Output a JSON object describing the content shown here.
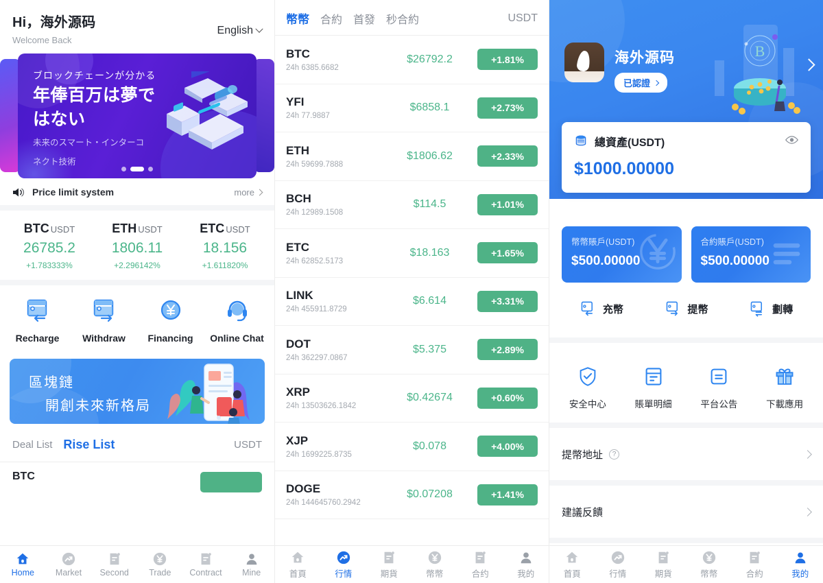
{
  "panel1": {
    "greeting": "Hi，海外源码",
    "welcome": "Welcome Back",
    "language": "English",
    "banner": {
      "line1": "ブロックチェーンが分かる",
      "line2": "年俸百万は夢で",
      "line3": "はない",
      "sub1": "未来のスマート・インターコ",
      "sub2": "ネクト技術"
    },
    "notice": {
      "text": "Price limit system",
      "more": "more"
    },
    "tickers": [
      {
        "symbol": "BTC",
        "unit": "USDT",
        "price": "26785.2",
        "change": "+1.783333%"
      },
      {
        "symbol": "ETH",
        "unit": "USDT",
        "price": "1806.11",
        "change": "+2.296142%"
      },
      {
        "symbol": "ETC",
        "unit": "USDT",
        "price": "18.156",
        "change": "+1.611820%"
      }
    ],
    "actions": [
      {
        "label": "Recharge",
        "icon": "wallet-in-icon"
      },
      {
        "label": "Withdraw",
        "icon": "wallet-out-icon"
      },
      {
        "label": "Financing",
        "icon": "yen-coin-icon"
      },
      {
        "label": "Online Chat",
        "icon": "headset-icon"
      }
    ],
    "banner2": {
      "line1": "區塊鏈",
      "line2": "開創未來新格局"
    },
    "deal_bar": {
      "deal_list": "Deal List",
      "rise_list": "Rise List",
      "unit": "USDT"
    },
    "partial_row": {
      "symbol": "BTC"
    },
    "tabbar": [
      {
        "label": "Home",
        "icon": "home-icon",
        "active": true
      },
      {
        "label": "Market",
        "icon": "trend-icon",
        "active": false
      },
      {
        "label": "Second",
        "icon": "doc-icon",
        "active": false
      },
      {
        "label": "Trade",
        "icon": "yen-icon",
        "active": false
      },
      {
        "label": "Contract",
        "icon": "doc-icon",
        "active": false
      },
      {
        "label": "Mine",
        "icon": "person-icon",
        "active": false
      }
    ]
  },
  "panel2": {
    "tabs": [
      {
        "label": "幣幣",
        "active": true
      },
      {
        "label": "合約",
        "active": false
      },
      {
        "label": "首發",
        "active": false
      },
      {
        "label": "秒合約",
        "active": false
      }
    ],
    "unit": "USDT",
    "coins": [
      {
        "symbol": "BTC",
        "volume": "24h 6385.6682",
        "price": "$26792.2",
        "change": "+1.81%"
      },
      {
        "symbol": "YFI",
        "volume": "24h 77.9887",
        "price": "$6858.1",
        "change": "+2.73%"
      },
      {
        "symbol": "ETH",
        "volume": "24h 59699.7888",
        "price": "$1806.62",
        "change": "+2.33%"
      },
      {
        "symbol": "BCH",
        "volume": "24h 12989.1508",
        "price": "$114.5",
        "change": "+1.01%"
      },
      {
        "symbol": "ETC",
        "volume": "24h 62852.5173",
        "price": "$18.163",
        "change": "+1.65%"
      },
      {
        "symbol": "LINK",
        "volume": "24h 455911.8729",
        "price": "$6.614",
        "change": "+3.31%"
      },
      {
        "symbol": "DOT",
        "volume": "24h 362297.0867",
        "price": "$5.375",
        "change": "+2.89%"
      },
      {
        "symbol": "XRP",
        "volume": "24h 13503626.1842",
        "price": "$0.42674",
        "change": "+0.60%"
      },
      {
        "symbol": "XJP",
        "volume": "24h 1699225.8735",
        "price": "$0.078",
        "change": "+4.00%"
      },
      {
        "symbol": "DOGE",
        "volume": "24h 144645760.2942",
        "price": "$0.07208",
        "change": "+1.41%"
      }
    ],
    "tabbar": [
      {
        "label": "首頁",
        "icon": "home-icon",
        "active": false
      },
      {
        "label": "行情",
        "icon": "trend-icon",
        "active": true
      },
      {
        "label": "期貨",
        "icon": "doc-icon",
        "active": false
      },
      {
        "label": "幣幣",
        "icon": "yen-icon",
        "active": false
      },
      {
        "label": "合约",
        "icon": "doc-icon",
        "active": false
      },
      {
        "label": "我的",
        "icon": "person-icon",
        "active": false
      }
    ]
  },
  "panel3": {
    "username": "海外源码",
    "verified_badge": "已認證",
    "asset": {
      "label": "總資產(USDT)",
      "value": "$1000.00000"
    },
    "accounts": [
      {
        "label": "幣幣賬戶(USDT)",
        "value": "$500.00000"
      },
      {
        "label": "合約賬戶(USDT)",
        "value": "$500.00000"
      }
    ],
    "ops": [
      {
        "label": "充幣",
        "icon": "wallet-in-icon"
      },
      {
        "label": "提幣",
        "icon": "wallet-out-icon"
      },
      {
        "label": "劃轉",
        "icon": "wallet-transfer-icon"
      }
    ],
    "grid": [
      {
        "label": "安全中心",
        "icon": "shield-check-icon"
      },
      {
        "label": "賬單明細",
        "icon": "bill-icon"
      },
      {
        "label": "平台公告",
        "icon": "announcement-icon"
      },
      {
        "label": "下載應用",
        "icon": "gift-icon"
      }
    ],
    "rows": [
      {
        "label": "提幣地址",
        "has_help": true
      },
      {
        "label": "建議反饋",
        "has_help": false
      }
    ],
    "tabbar": [
      {
        "label": "首頁",
        "icon": "home-icon",
        "active": false
      },
      {
        "label": "行情",
        "icon": "trend-icon",
        "active": false
      },
      {
        "label": "期貨",
        "icon": "doc-icon",
        "active": false
      },
      {
        "label": "幣幣",
        "icon": "yen-icon",
        "active": false
      },
      {
        "label": "合約",
        "icon": "doc-icon",
        "active": false
      },
      {
        "label": "我的",
        "icon": "person-icon",
        "active": true
      }
    ]
  },
  "colors": {
    "accent": "#1f6fe5",
    "green": "#4fb286",
    "green_text": "#4bb58a",
    "muted": "#9aa0a8"
  }
}
